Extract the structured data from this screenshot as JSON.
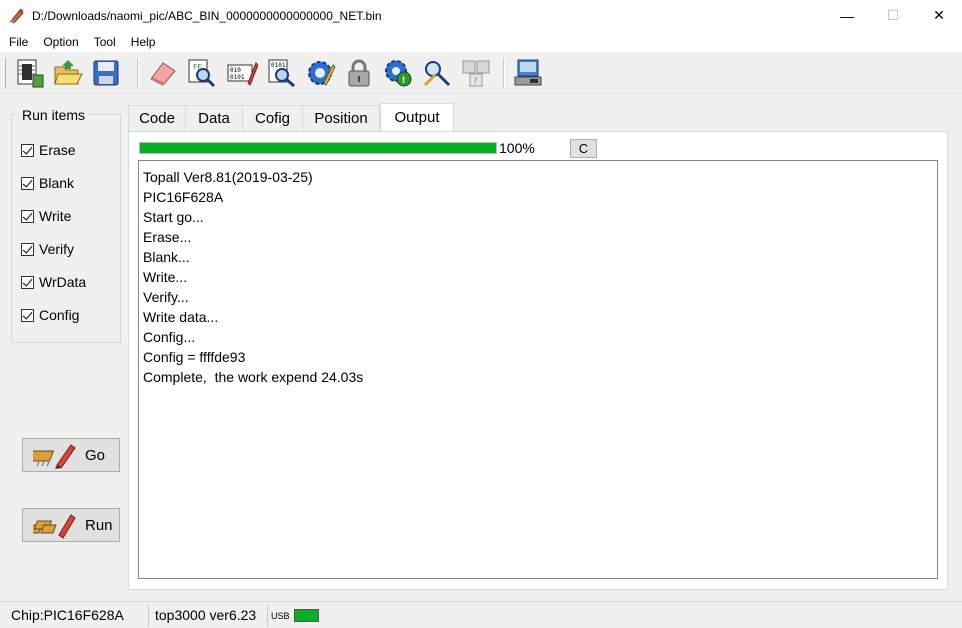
{
  "window": {
    "title": "D:/Downloads/naomi_pic/ABC_BIN_0000000000000000_NET.bin",
    "minimize": "—",
    "maximize": "☐",
    "close": "✕"
  },
  "menu": [
    "File",
    "Option",
    "Tool",
    "Help"
  ],
  "toolbar": {
    "buttons": [
      "chip-select-icon",
      "open-folder-icon",
      "save-disk-icon",
      "eraser-icon",
      "blank-check-icon",
      "program-icon",
      "verify-icon",
      "config-gear-icon",
      "lock-icon",
      "auto-run-icon",
      "tools-icon",
      "device-ids-icon",
      "programmer-hardware-icon"
    ]
  },
  "run_items": {
    "title": "Run items",
    "items": [
      {
        "label": "Erase",
        "checked": true
      },
      {
        "label": "Blank",
        "checked": true
      },
      {
        "label": "Write",
        "checked": true
      },
      {
        "label": "Verify",
        "checked": true
      },
      {
        "label": "WrData",
        "checked": true
      },
      {
        "label": "Config",
        "checked": true
      }
    ]
  },
  "buttons": {
    "go": "Go",
    "run": "Run",
    "clear": "C"
  },
  "tabs": [
    {
      "label": "Code",
      "active": false
    },
    {
      "label": "Data",
      "active": false
    },
    {
      "label": "Cofig",
      "active": false
    },
    {
      "label": "Position",
      "active": false
    },
    {
      "label": "Output",
      "active": true
    }
  ],
  "progress": {
    "fraction": 1.0,
    "label": "100%"
  },
  "output": {
    "lines": [
      "Topall Ver8.81(2019-03-25)",
      "PIC16F628A",
      "Start go...",
      "Erase...",
      "Blank...",
      "Write...",
      "Verify...",
      "Write data...",
      "Config...",
      "Config = ffffde93",
      "Complete,  the work expend 24.03s"
    ]
  },
  "status": {
    "chip": "Chip:PIC16F628A",
    "programmer": "top3000 ver6.23",
    "usb": "USB",
    "usb_color": "#06b025"
  }
}
